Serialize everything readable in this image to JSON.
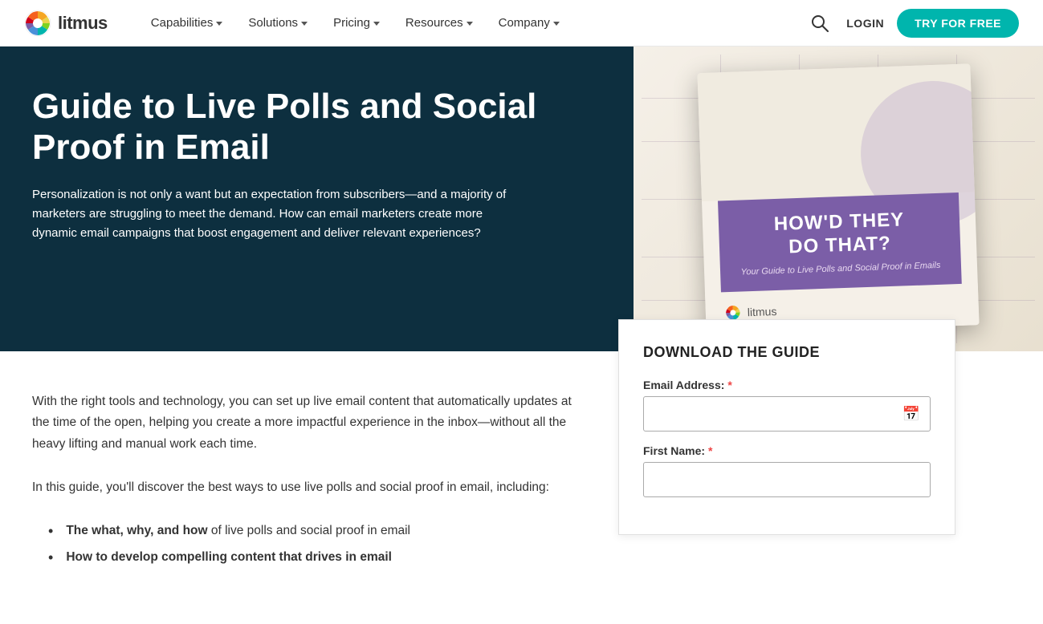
{
  "header": {
    "logo_text": "litmus",
    "nav_items": [
      {
        "label": "Capabilities",
        "has_dropdown": true
      },
      {
        "label": "Solutions",
        "has_dropdown": true
      },
      {
        "label": "Pricing",
        "has_dropdown": true
      },
      {
        "label": "Resources",
        "has_dropdown": true
      },
      {
        "label": "Company",
        "has_dropdown": true
      }
    ],
    "login_label": "LOGIN",
    "try_free_label": "TRY FOR FREE"
  },
  "hero": {
    "title": "Guide to Live Polls and Social Proof in Email",
    "description": "Personalization is not only a want but an expectation from subscribers—and a majority of marketers are struggling to meet the demand. How can email marketers create more dynamic email campaigns that boost engagement and deliver relevant experiences?",
    "book": {
      "title_line1": "HOW'D THEY",
      "title_line2": "DO THAT?",
      "subtitle": "Your Guide to Live Polls and Social Proof in Emails",
      "logo_text": "litmus"
    }
  },
  "main": {
    "paragraph1": "With the right tools and technology, you can set up live email content that automatically updates at the time of the open, helping you create a more impactful experience in the inbox—without all the heavy lifting and manual work each time.",
    "paragraph2": "In this guide, you'll discover the best ways to use live polls and social proof in email, including:",
    "bullets": [
      {
        "bold": "The what, why, and how",
        "text": " of live polls and social proof in email"
      },
      {
        "bold": "How to develop compelling content that drives in email",
        "text": ""
      }
    ]
  },
  "form": {
    "download_title": "DOWNLOAD THE GUIDE",
    "email_label": "Email Address:",
    "email_required": "*",
    "firstname_label": "First Name:",
    "firstname_required": "*"
  },
  "colors": {
    "teal": "#00b5ad",
    "dark_navy": "#0d2f3f",
    "purple": "#7b5ea7"
  }
}
